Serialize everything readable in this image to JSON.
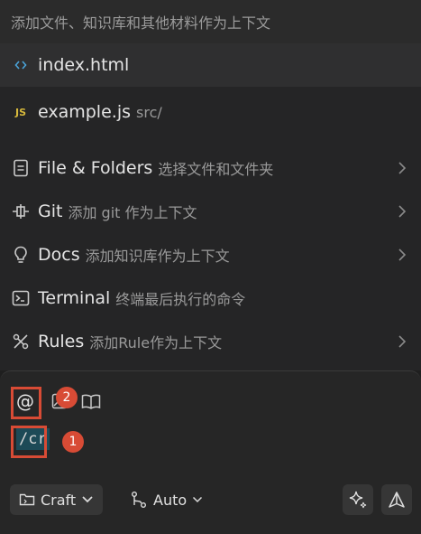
{
  "header": {
    "placeholder": "添加文件、知识库和其他材料作为上下文"
  },
  "files": [
    {
      "name": "index.html",
      "path": "",
      "icon": "code-brackets-icon"
    },
    {
      "name": "example.js",
      "path": "src/",
      "icon": "js-file-icon",
      "icon_text": "JS"
    }
  ],
  "context_items": [
    {
      "label": "File & Folders",
      "desc": "选择文件和文件夹",
      "icon": "document-icon"
    },
    {
      "label": "Git",
      "desc": "添加 git 作为上下文",
      "icon": "git-commit-icon"
    },
    {
      "label": "Docs",
      "desc": "添加知识库作为上下文",
      "icon": "lightbulb-icon"
    },
    {
      "label": "Terminal",
      "desc": "终端最后执行的命令",
      "icon": "terminal-icon"
    },
    {
      "label": "Rules",
      "desc": "添加Rule作为上下文",
      "icon": "rules-icon"
    }
  ],
  "input": {
    "at_symbol": "@",
    "command_text": "/cr",
    "annotations": [
      "1",
      "2"
    ]
  },
  "toolbar": {
    "mode_label": "Craft",
    "model_label": "Auto"
  },
  "colors": {
    "annotation_red": "#d84b35",
    "command_highlight": "#1d4a57",
    "js_yellow": "#d7b93c"
  }
}
